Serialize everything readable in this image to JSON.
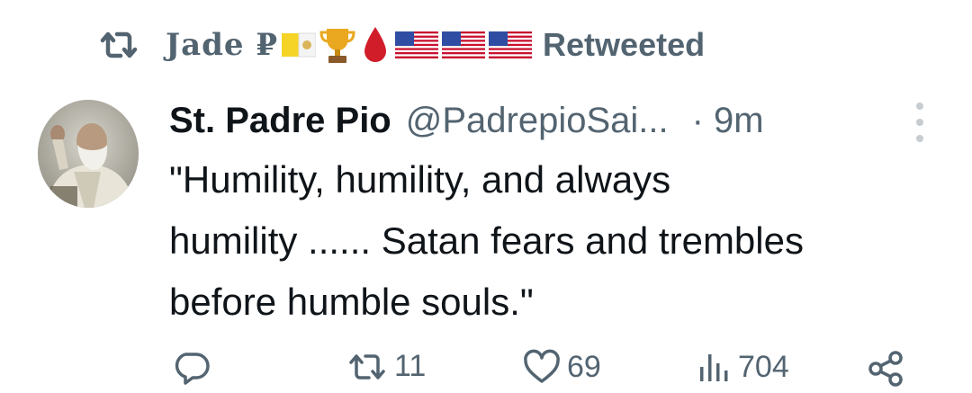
{
  "retweet": {
    "icon": "retweet-icon",
    "user_name": "Jade ₽",
    "emojis": [
      "vatican-flag-icon",
      "trophy-icon",
      "blood-drop-icon",
      "us-flag-icon",
      "us-flag-icon",
      "us-flag-icon"
    ],
    "label": "Retweeted"
  },
  "tweet": {
    "avatar": "avatar-padre-pio",
    "display_name": "St. Padre Pio",
    "handle": "@PadrepioSai...",
    "time": "· 9m",
    "text_lines": [
      "\"Humility, humility, and always",
      "humility ...... Satan fears and trembles",
      "before humble souls.\""
    ]
  },
  "actions": {
    "reply": {
      "icon": "reply-icon",
      "count": ""
    },
    "retweet": {
      "icon": "retweet-icon",
      "count": "11"
    },
    "like": {
      "icon": "heart-icon",
      "count": "69"
    },
    "views": {
      "icon": "views-icon",
      "count": "704"
    },
    "share": {
      "icon": "share-icon"
    }
  },
  "colors": {
    "text_primary": "#0f1419",
    "text_secondary": "#536471",
    "background": "#ffffff"
  }
}
